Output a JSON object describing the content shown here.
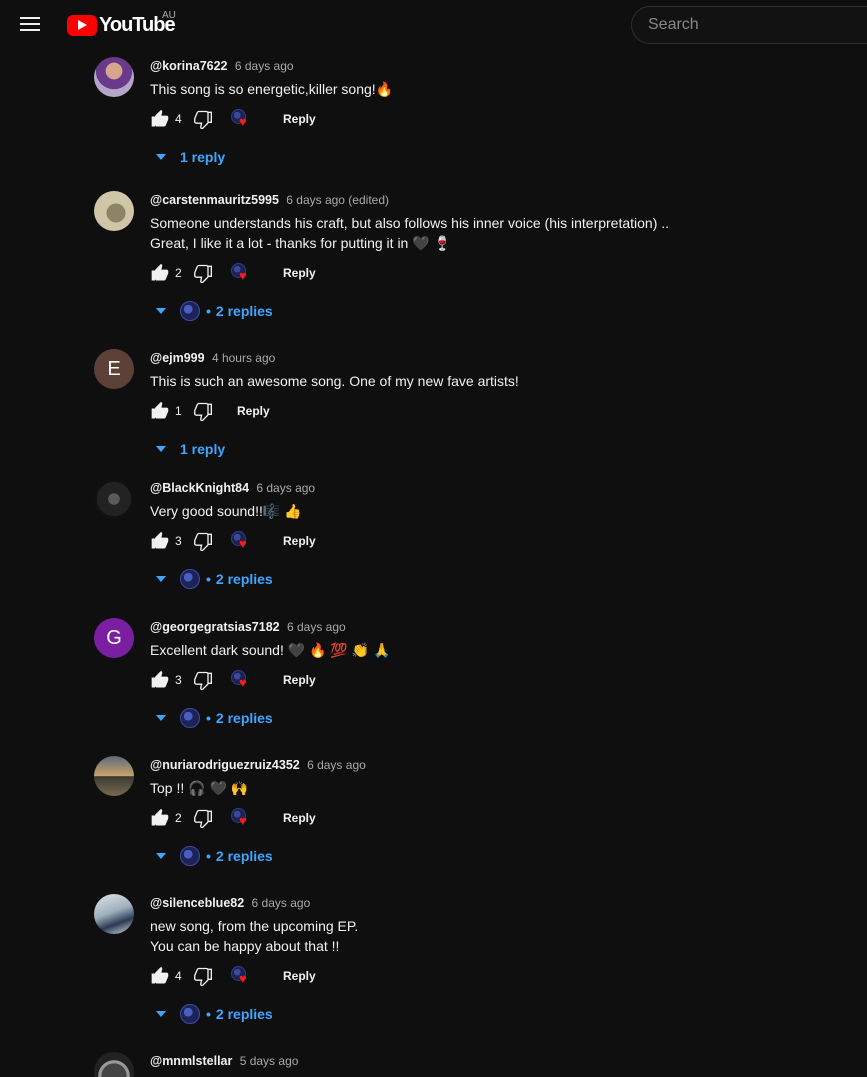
{
  "header": {
    "logo_text": "YouTube",
    "country_code": "AU",
    "search_placeholder": "Search"
  },
  "reply_label": "Reply",
  "comments": [
    {
      "author": "@korina7622",
      "time": "6 days ago",
      "text": "This song is so energetic,killer song!🔥",
      "likes": "4",
      "hearted": true,
      "replies_label": "1 reply",
      "replies_owner_avatar": false
    },
    {
      "author": "@carstenmauritz5995",
      "time": "6 days ago (edited)",
      "text": "Someone understands his craft, but also follows his inner voice (his interpretation) ..\nGreat, I like it a lot - thanks for putting it in 🖤 🍷",
      "likes": "2",
      "hearted": true,
      "replies_label": "2 replies",
      "replies_owner_avatar": true
    },
    {
      "author": "@ejm999",
      "time": "4 hours ago",
      "text": "This is such an awesome song. One of my new fave artists!",
      "likes": "1",
      "hearted": false,
      "avatar_letter": "E",
      "replies_label": "1 reply",
      "replies_owner_avatar": false
    },
    {
      "author": "@BlackKnight84",
      "time": "6 days ago",
      "text": "Very good sound!!🎼 👍",
      "likes": "3",
      "hearted": true,
      "replies_label": "2 replies",
      "replies_owner_avatar": true
    },
    {
      "author": "@georgegratsias7182",
      "time": "6 days ago",
      "text": "Excellent dark sound! 🖤 🔥 💯 👏 🙏",
      "likes": "3",
      "hearted": true,
      "avatar_letter": "G",
      "replies_label": "2 replies",
      "replies_owner_avatar": true
    },
    {
      "author": "@nuriarodriguezruiz4352",
      "time": "6 days ago",
      "text": "Top !! 🎧 🖤 🙌",
      "likes": "2",
      "hearted": true,
      "replies_label": "2 replies",
      "replies_owner_avatar": true
    },
    {
      "author": "@silenceblue82",
      "time": "6 days ago",
      "text": "new song, from the upcoming EP.\nYou can be happy about that !!",
      "likes": "4",
      "hearted": true,
      "replies_label": "2 replies",
      "replies_owner_avatar": true
    },
    {
      "author": "@mnmlstellar",
      "time": "5 days ago"
    }
  ],
  "colors": {
    "background": "#0f0f0f",
    "link_blue": "#3ea6ff",
    "heart_red": "#ff1a1a",
    "brand_red": "#ff0000"
  }
}
